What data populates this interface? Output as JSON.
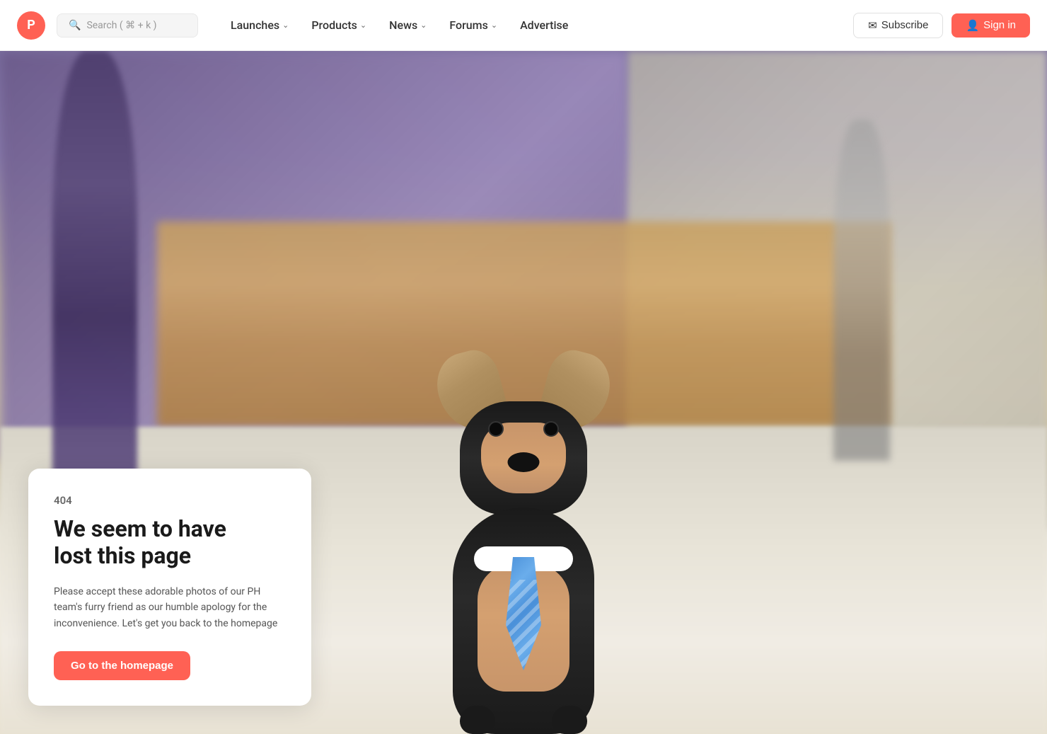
{
  "navbar": {
    "logo_letter": "P",
    "search_placeholder": "Search ( ⌘ + k )",
    "nav_items": [
      {
        "label": "Launches",
        "has_dropdown": true
      },
      {
        "label": "Products",
        "has_dropdown": true
      },
      {
        "label": "News",
        "has_dropdown": true
      },
      {
        "label": "Forums",
        "has_dropdown": true
      },
      {
        "label": "Advertise",
        "has_dropdown": false
      }
    ],
    "subscribe_label": "Subscribe",
    "signin_label": "Sign in"
  },
  "error_page": {
    "code": "404",
    "title_line1": "We seem to have",
    "title_line2": "lost this page",
    "description": "Please accept these adorable photos of our PH team's furry friend as our humble apology for the inconvenience. Let's get you back to the homepage",
    "cta_label": "Go to the homepage"
  },
  "colors": {
    "brand": "#ff6154",
    "text_dark": "#1a1a1a",
    "text_muted": "#666666",
    "bg_white": "#ffffff"
  },
  "icons": {
    "search": "🔍",
    "subscribe": "✉",
    "signin": "👤",
    "chevron": "›"
  }
}
